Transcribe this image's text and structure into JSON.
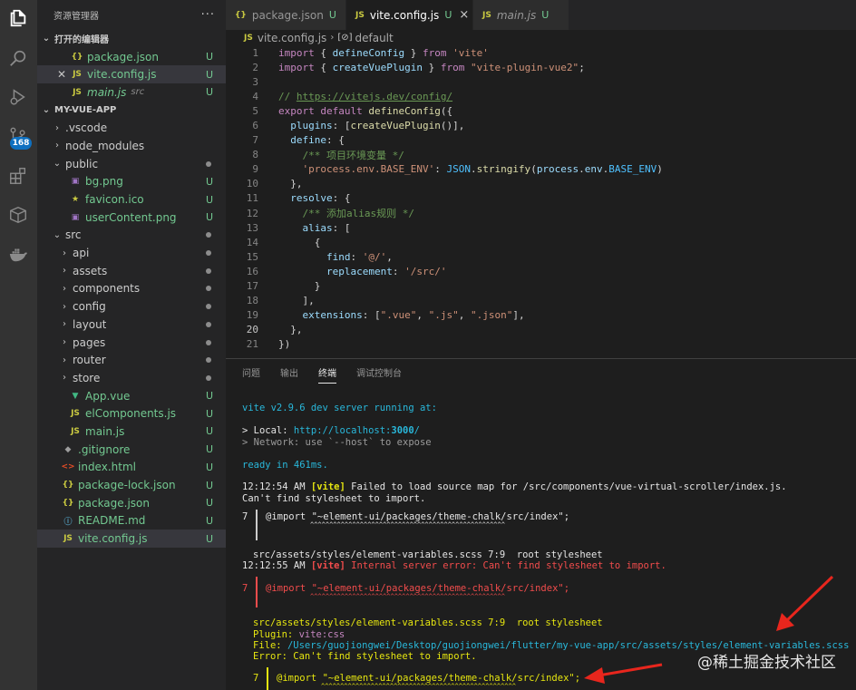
{
  "sidebar": {
    "title": "资源管理器",
    "more": "···",
    "open_editors_label": "打开的编辑器",
    "open_editors": [
      {
        "icon": "{}",
        "name": "package.json",
        "status": "U"
      },
      {
        "icon": "JS",
        "name": "vite.config.js",
        "status": "U"
      },
      {
        "icon": "JS",
        "name": "main.js",
        "desc": "src",
        "status": "U"
      }
    ],
    "project_label": "MY-VUE-APP",
    "tree": [
      {
        "name": ".vscode"
      },
      {
        "name": "node_modules"
      },
      {
        "name": "public"
      },
      {
        "name": "bg.png",
        "status": "U"
      },
      {
        "name": "favicon.ico",
        "status": "U"
      },
      {
        "name": "userContent.png",
        "status": "U"
      },
      {
        "name": "src"
      },
      {
        "name": "api"
      },
      {
        "name": "assets"
      },
      {
        "name": "components"
      },
      {
        "name": "config"
      },
      {
        "name": "layout"
      },
      {
        "name": "pages"
      },
      {
        "name": "router"
      },
      {
        "name": "store"
      },
      {
        "name": "App.vue",
        "status": "U"
      },
      {
        "name": "elComponents.js",
        "status": "U"
      },
      {
        "name": "main.js",
        "status": "U"
      },
      {
        "name": ".gitignore",
        "status": "U"
      },
      {
        "name": "index.html",
        "status": "U"
      },
      {
        "name": "package-lock.json",
        "status": "U"
      },
      {
        "name": "package.json",
        "status": "U"
      },
      {
        "name": "README.md",
        "status": "U"
      },
      {
        "name": "vite.config.js",
        "status": "U"
      }
    ]
  },
  "activity": {
    "badge": "168"
  },
  "tabs": [
    {
      "icon": "{}",
      "label": "package.json",
      "status": "U"
    },
    {
      "icon": "JS",
      "label": "vite.config.js",
      "status": "U",
      "close": "×"
    },
    {
      "icon": "JS",
      "label": "main.js",
      "status": "U"
    }
  ],
  "breadcrumb": {
    "file": "vite.config.js",
    "symbol": "default"
  },
  "code": {
    "line_numbers": [
      "1",
      "2",
      "3",
      "4",
      "5",
      "6",
      "7",
      "8",
      "9",
      "10",
      "11",
      "12",
      "13",
      "14",
      "15",
      "16",
      "17",
      "18",
      "19",
      "20",
      "21"
    ]
  },
  "panel": {
    "tabs": [
      "问题",
      "输出",
      "终端",
      "调试控制台"
    ]
  },
  "terminal": {
    "vite_header": "vite v2.9.6 dev server running at:",
    "local_label": "> Local: ",
    "local_url_a": "http://localhost:",
    "local_url_port": "3000",
    "local_url_b": "/",
    "network": "> Network: use `--host` to expose",
    "ready": "ready in 461ms.",
    "t1": "12:12:54 AM",
    "vite_tag": "[vite]",
    "msg1": " Failed to load source map for /src/components/vue-virtual-scroller/index.js.",
    "msg2": "Can't find stylesheet to import.",
    "lno": "7",
    "import_line": "@import \"~element-ui/packages/theme-chalk/src/index\";",
    "squiggle": "^^^^^^^^^^^^^^^^^^^^^^^^^^^^^^^^^^^^^^^^^^^^^^^^^^^",
    "loc1": "src/assets/styles/element-variables.scss 7:9  root stylesheet",
    "t2": "12:12:55 AM",
    "msg3": " Internal server error: Can't find stylesheet to import.",
    "plugin_label": "Plugin: ",
    "plugin_value": "vite:css",
    "file_label": "File: ",
    "file_value": "/Users/guojiongwei/Desktop/guojiongwei/flutter/my-vue-app/src/assets/styles/element-variables.scss",
    "error_line": "Error: Can't find stylesheet to import."
  },
  "watermark": "@稀土掘金技术社区",
  "colors": {
    "accent": "#0e70c0",
    "arrow": "#e8261d"
  }
}
